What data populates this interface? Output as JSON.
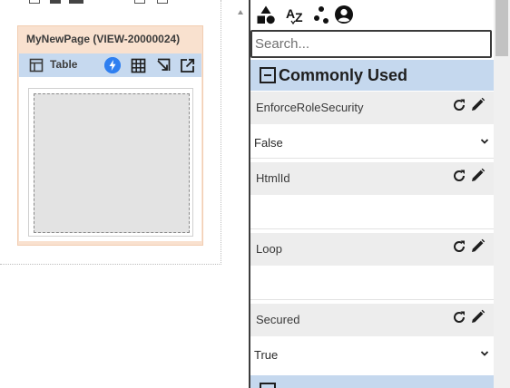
{
  "canvas": {
    "page_title": "MyNewPage (VIEW-20000024)",
    "table_label": "Table"
  },
  "properties": {
    "search_placeholder": "Search...",
    "group_title": "Commonly Used",
    "items": [
      {
        "label": "EnforceRoleSecurity",
        "value": "False",
        "control": "select"
      },
      {
        "label": "HtmlId",
        "value": "",
        "control": "text"
      },
      {
        "label": "Loop",
        "value": "",
        "control": "text"
      },
      {
        "label": "Secured",
        "value": "True",
        "control": "select"
      }
    ]
  },
  "icons": {
    "toolbar": [
      "shapes-icon",
      "sort-az-icon",
      "dependencies-icon",
      "user-circle-icon"
    ],
    "table_bar": [
      "table-icon",
      "bolt-icon",
      "grid-icon",
      "resize-icon",
      "open-external-icon"
    ]
  },
  "colors": {
    "page_card": "#f9e1cf",
    "table_bar": "#c6d9ef",
    "group_header": "#c5d8ee",
    "event_blue": "#2f7ff0"
  }
}
